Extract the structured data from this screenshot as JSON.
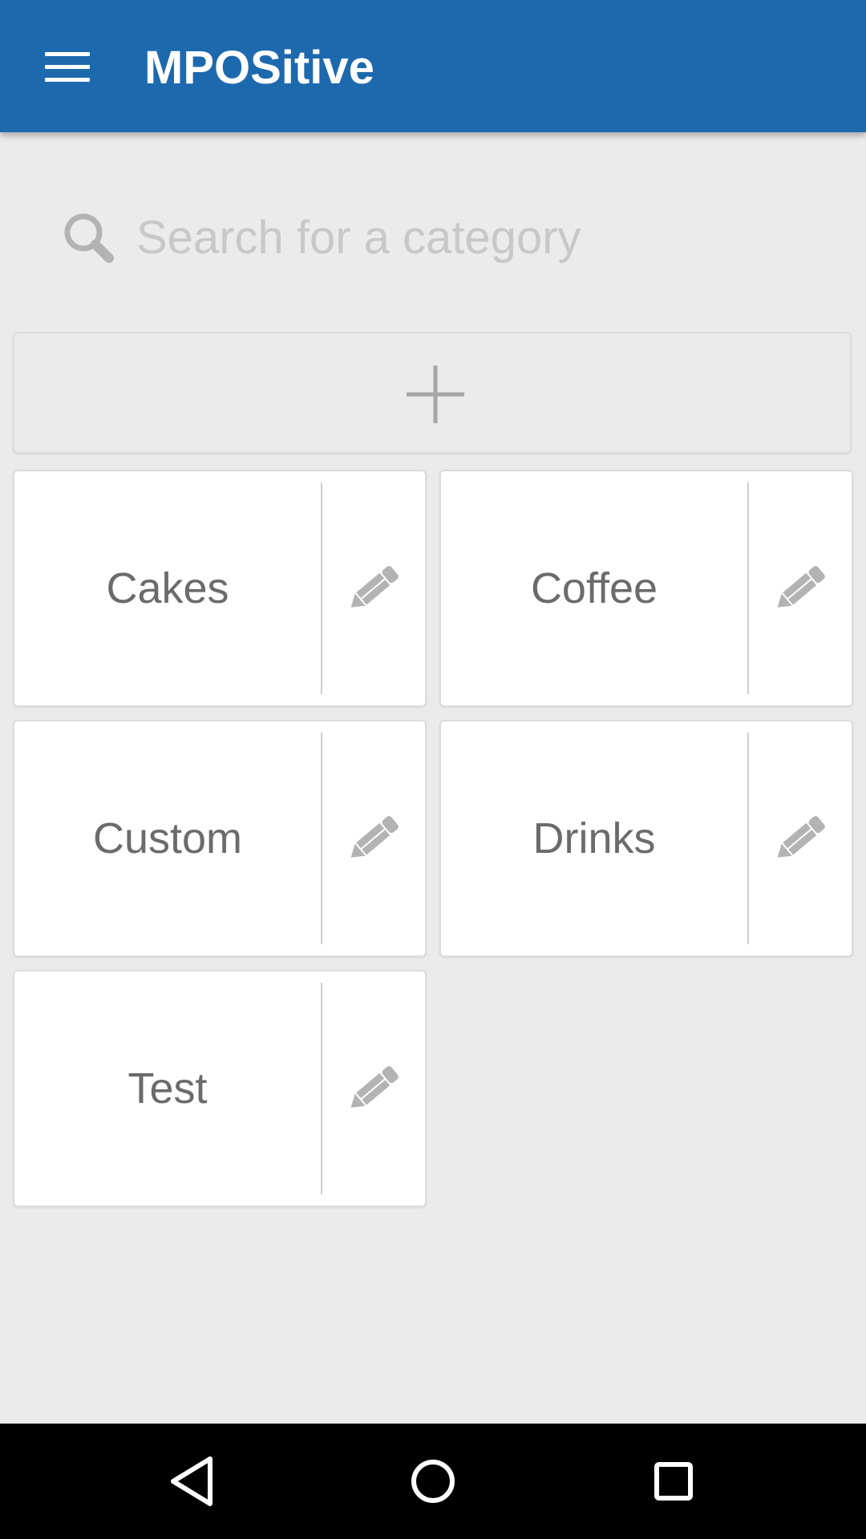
{
  "app_bar": {
    "title": "MPOSitive",
    "menu_icon": "hamburger-menu-icon",
    "background_color": "#1d69ae"
  },
  "search": {
    "placeholder": "Search for a category",
    "value": "",
    "icon": "search-icon"
  },
  "add_category": {
    "icon": "plus-icon"
  },
  "categories": [
    {
      "label": "Cakes",
      "edit_icon": "pencil-icon"
    },
    {
      "label": "Coffee",
      "edit_icon": "pencil-icon"
    },
    {
      "label": "Custom",
      "edit_icon": "pencil-icon"
    },
    {
      "label": "Drinks",
      "edit_icon": "pencil-icon"
    },
    {
      "label": "Test",
      "edit_icon": "pencil-icon"
    }
  ],
  "nav_bar": {
    "back_icon": "back-triangle-icon",
    "home_icon": "home-circle-icon",
    "recents_icon": "recents-square-icon"
  }
}
